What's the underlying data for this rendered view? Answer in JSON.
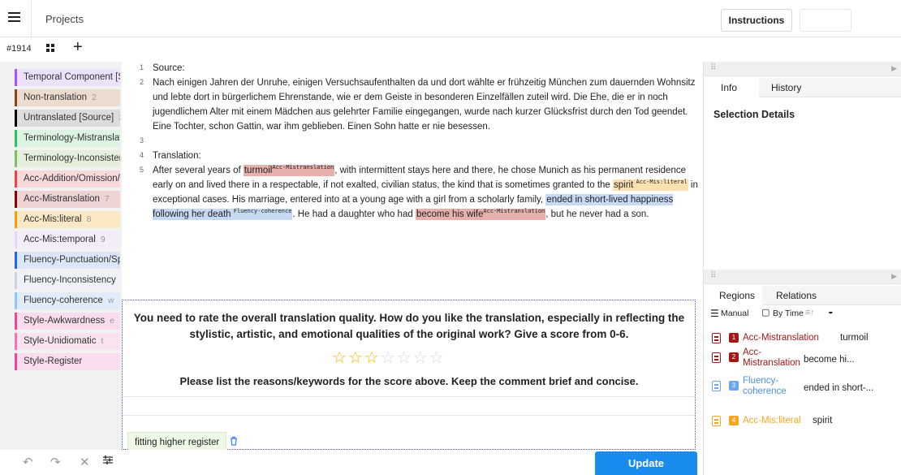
{
  "header": {
    "projects_label": "Projects",
    "instructions_label": "Instructions"
  },
  "task": {
    "id": "#1914"
  },
  "labels": [
    {
      "name": "Temporal Component [S",
      "hotkey": "",
      "color": "#a855f7",
      "bg": "#ede2fb"
    },
    {
      "name": "Non-translation",
      "hotkey": "2",
      "color": "#8b4513",
      "bg": "#ecdcd0"
    },
    {
      "name": "Untranslated [Source]",
      "hotkey": "3",
      "color": "#000000",
      "bg": "#dcdcdc"
    },
    {
      "name": "Terminology-Mistranslat",
      "hotkey": "",
      "color": "#22c55e",
      "bg": "#def4e3"
    },
    {
      "name": "Terminology-Inconsister",
      "hotkey": "",
      "color": "#7fbf63",
      "bg": "#e5f0dc"
    },
    {
      "name": "Acc-Addition/Omission/",
      "hotkey": "",
      "color": "#ef4444",
      "bg": "#f7d9d9"
    },
    {
      "name": "Acc-Mistranslation",
      "hotkey": "7",
      "color": "#8b0000",
      "bg": "#eed3d3"
    },
    {
      "name": "Acc-Mis:literal",
      "hotkey": "8",
      "color": "#f59e0b",
      "bg": "#fbe8c4"
    },
    {
      "name": "Acc-Mis:temporal",
      "hotkey": "9",
      "color": "#e9d5ff",
      "bg": "#f3ecf9"
    },
    {
      "name": "Fluency-Punctuation/Sp",
      "hotkey": "",
      "color": "#2563eb",
      "bg": "#dbe6f8"
    },
    {
      "name": "Fluency-Inconsistency",
      "hotkey": "",
      "color": "#cbd5e1",
      "bg": "#eef1f5"
    },
    {
      "name": "Fluency-coherence",
      "hotkey": "w",
      "color": "#93c5fd",
      "bg": "#e1ecfa"
    },
    {
      "name": "Style-Awkwardness",
      "hotkey": "e",
      "color": "#ec4899",
      "bg": "#f9dced"
    },
    {
      "name": "Style-Unidiomatic",
      "hotkey": "t",
      "color": "#f472b6",
      "bg": "#f9e3ee"
    },
    {
      "name": "Style-Register",
      "hotkey": "",
      "color": "#ec4899",
      "bg": "#f9dced"
    }
  ],
  "editor": {
    "line_numbers": [
      "1",
      "2",
      "3",
      "4",
      "5"
    ],
    "source_heading": "Source:",
    "source_text": "Nach einigen Jahren der Unruhe, einigen Versuchsaufenthalten da und dort wählte er frühzeitig München zum dauernden Wohnsitz und lebte dort in bürgerlichem Ehrenstande, wie er dem Geiste in besonderen Einzelfällen zuteil wird. Die Ehe, die er in noch jugendlichem Alter mit einem Mädchen aus gelehrter Familie eingegangen, wurde nach kurzer Glücksfrist durch den Tod geendet. Eine Tochter, schon Gattin, war ihm geblieben. Einen Sohn hatte er nie besessen.",
    "translation_heading": "Translation:",
    "t": {
      "p1": "After several years of ",
      "h1": "turmoil",
      "s1": "Acc-Mistranslation",
      "p2": ", with intermittent stays here and there, he chose Munich as his permanent residence early on and lived there in a respectable, if not exalted, civilian status, the kind that is sometimes granted to the ",
      "h2": "spirit",
      "s2": "Acc-Mis:literal",
      "p3": " in exceptional cases. His marriage, entered into at a young age with a girl from a scholarly family, ",
      "h3": "ended in short-lived happiness following her death",
      "s3": "Fluency-coherence",
      "p4": ". He had a daughter who had ",
      "h4": "become his wife",
      "s4": "Acc-Mistranslation",
      "p5": ", but he never had a son."
    }
  },
  "rating": {
    "question": "You need to rate the overall translation quality. How do you like the translation, especially in reflecting the stylistic, artistic, and emotional qualities of the original work? Give a score from 0-6.",
    "score": 3,
    "max_stars": 7,
    "comment_prompt": "Please list the reasons/keywords for the score above. Keep the comment brief and concise.",
    "comment_value": "",
    "submitted_comment": "fitting higher register"
  },
  "bottom": {
    "update_label": "Update"
  },
  "info_panel": {
    "tabs": [
      "Info",
      "History"
    ],
    "active_tab": "Info",
    "selection_title": "Selection Details"
  },
  "regions_panel": {
    "tabs": [
      "Regions",
      "Relations"
    ],
    "active_tab": "Regions",
    "sort_manual": "Manual",
    "sort_by_time": "By Time",
    "regions": [
      {
        "num": "1",
        "label": "Acc-Mistranslation",
        "text": "turmoil",
        "color": "#a01818",
        "label_color": "#a01818"
      },
      {
        "num": "2",
        "label": "Acc-Mistranslation",
        "text": "become hi...",
        "color": "#a01818",
        "label_color": "#a01818"
      },
      {
        "num": "3",
        "label": "Fluency-coherence",
        "text": "ended in short-...",
        "color": "#6aa6ee",
        "label_color": "#4a90e2"
      },
      {
        "num": "4",
        "label": "Acc-Mis:literal",
        "text": "spirit",
        "color": "#f5a623",
        "label_color": "#f5a623"
      }
    ]
  },
  "icons": {
    "menu": "hamburger-icon",
    "grid": "grid-icon",
    "add": "plus-icon",
    "undo": "undo-icon",
    "redo": "redo-icon",
    "reset": "close-icon",
    "settings": "sliders-icon",
    "delete": "trash-icon",
    "region": "document-icon",
    "eye": "eye-icon"
  }
}
